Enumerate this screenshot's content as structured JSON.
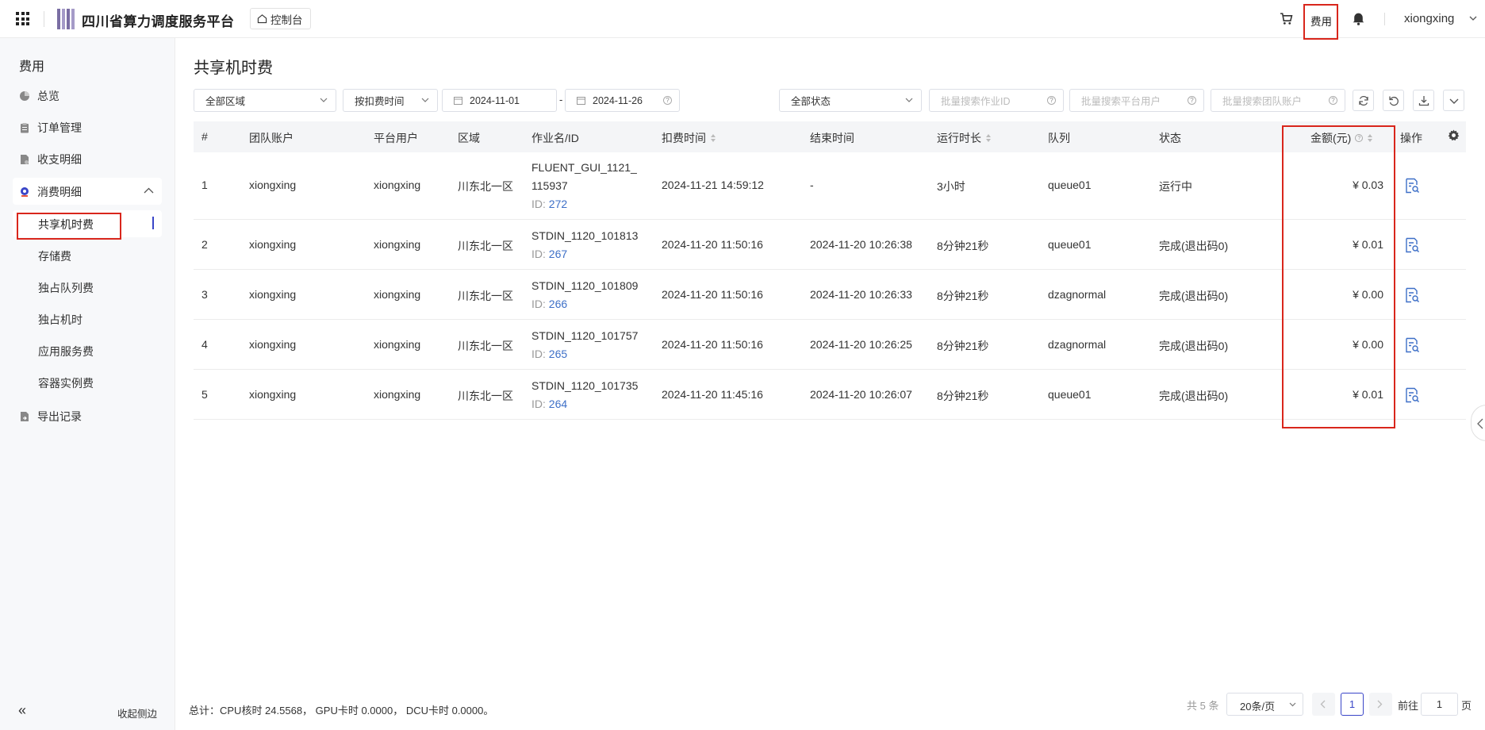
{
  "header": {
    "app_title": "四川省算力调度服务平台",
    "console_label": "控制台",
    "fee_label": "费用",
    "username": "xiongxing"
  },
  "sidebar": {
    "title": "费用",
    "items": [
      {
        "label": "总览",
        "icon": "pie-chart-icon"
      },
      {
        "label": "订单管理",
        "icon": "clipboard-icon"
      },
      {
        "label": "收支明细",
        "icon": "document-icon"
      }
    ],
    "group": {
      "label": "消费明细",
      "icon": "consumption-icon"
    },
    "sub_items": [
      "共享机时费",
      "存储费",
      "独占队列费",
      "独占机时",
      "应用服务费",
      "容器实例费"
    ],
    "export": {
      "label": "导出记录",
      "icon": "export-icon"
    },
    "collapse_label": "收起侧边",
    "collapse_icon": "«"
  },
  "main": {
    "title": "共享机时费",
    "filters": {
      "region": "全部区域",
      "time_type": "按扣费时间",
      "date_start": "2024-11-01",
      "date_end": "2024-11-26",
      "date_sep": "-",
      "status": "全部状态",
      "job_placeholder": "批量搜索作业ID",
      "user_placeholder": "批量搜索平台用户",
      "team_placeholder": "批量搜索团队账户"
    },
    "columns": {
      "index": "#",
      "team": "团队账户",
      "user": "平台用户",
      "region": "区域",
      "job": "作业名/ID",
      "deduct_time": "扣费时间",
      "end_time": "结束时间",
      "duration": "运行时长",
      "queue": "队列",
      "status": "状态",
      "amount": "金额(元)",
      "action": "操作"
    },
    "rows": [
      {
        "idx": "1",
        "team": "xiongxing",
        "user": "xiongxing",
        "region": "川东北一区",
        "job_name": "FLUENT_GUI_1121_115937",
        "id_label": "ID:",
        "job_id": "272",
        "deduct_time": "2024-11-21 14:59:12",
        "end_time": "-",
        "duration": "3小时",
        "queue": "queue01",
        "status": "运行中",
        "amount": "¥ 0.03"
      },
      {
        "idx": "2",
        "team": "xiongxing",
        "user": "xiongxing",
        "region": "川东北一区",
        "job_name": "STDIN_1120_101813",
        "id_label": "ID:",
        "job_id": "267",
        "deduct_time": "2024-11-20 11:50:16",
        "end_time": "2024-11-20 10:26:38",
        "duration": "8分钟21秒",
        "queue": "queue01",
        "status": "完成(退出码0)",
        "amount": "¥ 0.01"
      },
      {
        "idx": "3",
        "team": "xiongxing",
        "user": "xiongxing",
        "region": "川东北一区",
        "job_name": "STDIN_1120_101809",
        "id_label": "ID:",
        "job_id": "266",
        "deduct_time": "2024-11-20 11:50:16",
        "end_time": "2024-11-20 10:26:33",
        "duration": "8分钟21秒",
        "queue": "dzagnormal",
        "status": "完成(退出码0)",
        "amount": "¥ 0.00"
      },
      {
        "idx": "4",
        "team": "xiongxing",
        "user": "xiongxing",
        "region": "川东北一区",
        "job_name": "STDIN_1120_101757",
        "id_label": "ID:",
        "job_id": "265",
        "deduct_time": "2024-11-20 11:50:16",
        "end_time": "2024-11-20 10:26:25",
        "duration": "8分钟21秒",
        "queue": "dzagnormal",
        "status": "完成(退出码0)",
        "amount": "¥ 0.00"
      },
      {
        "idx": "5",
        "team": "xiongxing",
        "user": "xiongxing",
        "region": "川东北一区",
        "job_name": "STDIN_1120_101735",
        "id_label": "ID:",
        "job_id": "264",
        "deduct_time": "2024-11-20 11:45:16",
        "end_time": "2024-11-20 10:26:07",
        "duration": "8分钟21秒",
        "queue": "queue01",
        "status": "完成(退出码0)",
        "amount": "¥ 0.01"
      }
    ],
    "summary": "总计：CPU核时 24.5568， GPU卡时 0.0000， DCU卡时 0.0000。"
  },
  "pagination": {
    "total": "共 5 条",
    "page_size": "20条/页",
    "current": "1",
    "goto_label": "前往",
    "goto_value": "1",
    "page_suffix": "页"
  },
  "colors": {
    "accent": "#3a46c8",
    "highlight": "#d9261c",
    "link": "#3d6fc7"
  }
}
